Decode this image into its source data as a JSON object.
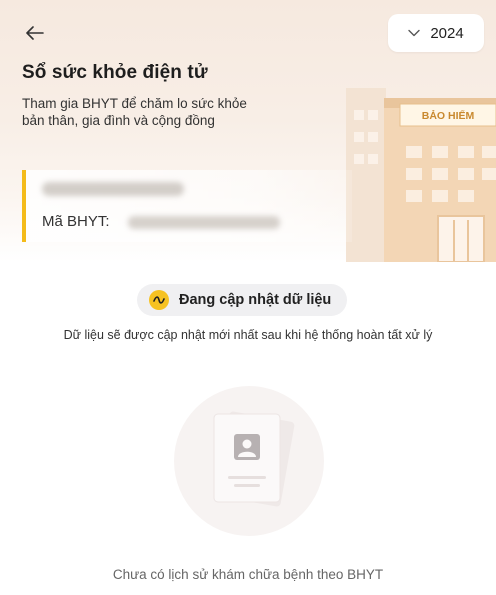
{
  "header": {
    "back_icon": "arrow-left-icon",
    "year_select": {
      "value": "2024",
      "icon": "chevron-down-icon"
    },
    "title": "Sổ sức khỏe điện tử",
    "subtitle_line1": "Tham gia BHYT để chăm lo sức khỏe",
    "subtitle_line2": "bản thân, gia đình và cộng đồng",
    "building_sign": "BẢO HIỂM"
  },
  "card": {
    "bhyt_label": "Mã BHYT:"
  },
  "status": {
    "label": "Đang cập nhật dữ liệu",
    "icon": "wave-icon",
    "description": "Dữ liệu sẽ được cập nhật mới nhất sau khi hệ thống hoàn tất xử lý"
  },
  "empty_state": {
    "icon": "profile-document-icon",
    "message": "Chưa có lịch sử khám chữa bệnh theo BHYT"
  },
  "colors": {
    "accent": "#f4bb1a",
    "header_bg": "#f6e9df",
    "sign_text": "#c9892f"
  }
}
